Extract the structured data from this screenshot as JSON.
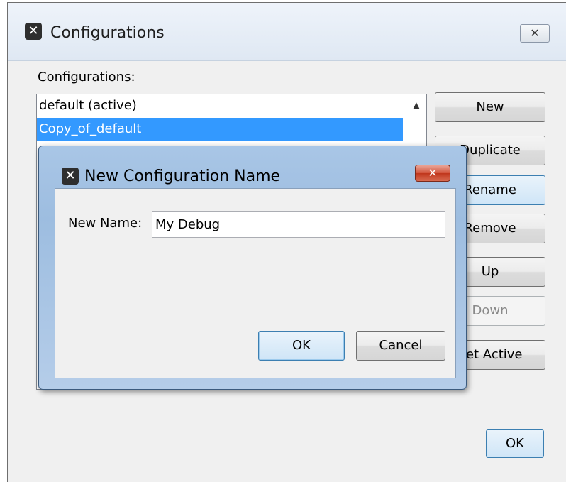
{
  "outer_dialog": {
    "title": "Configurations",
    "close_glyph": "✕",
    "icon_glyph": "✕",
    "list_label": "Configurations:",
    "list_items": [
      {
        "label": "default (active)",
        "selected": false
      },
      {
        "label": "Copy_of_default",
        "selected": true
      }
    ],
    "scroll_up_glyph": "▲",
    "buttons": {
      "new": "New",
      "duplicate": "Duplicate",
      "rename": "Rename",
      "remove": "Remove",
      "up": "Up",
      "down": "Down",
      "set_active": "Set Active"
    },
    "ok_label": "OK"
  },
  "modal": {
    "title": "New Configuration Name",
    "icon_glyph": "✕",
    "close_glyph": "✕",
    "field_label": "New Name:",
    "field_value": "My Debug",
    "ok_label": "OK",
    "cancel_label": "Cancel"
  },
  "colors": {
    "selection": "#3399ff",
    "modal_frame": "#a9c6e6",
    "close_red": "#c0361c"
  }
}
